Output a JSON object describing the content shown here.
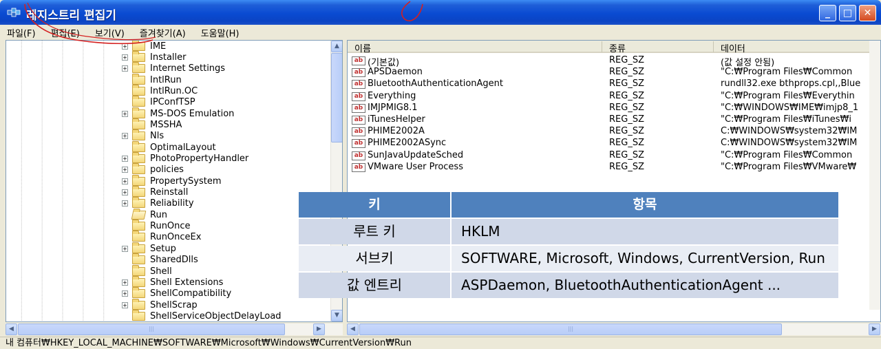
{
  "window": {
    "title": "레지스트리 편집기",
    "buttons": {
      "minimize": "_",
      "maximize": "□",
      "close": "✕"
    }
  },
  "menu": [
    "파일(F)",
    "편집(E)",
    "보기(V)",
    "즐겨찾기(A)",
    "도움말(H)"
  ],
  "tree": {
    "items": [
      {
        "label": "IME",
        "expandable": true
      },
      {
        "label": "Installer",
        "expandable": true
      },
      {
        "label": "Internet Settings",
        "expandable": true
      },
      {
        "label": "IntlRun",
        "expandable": false
      },
      {
        "label": "IntlRun.OC",
        "expandable": false
      },
      {
        "label": "IPConfTSP",
        "expandable": false
      },
      {
        "label": "MS-DOS Emulation",
        "expandable": true
      },
      {
        "label": "MSSHA",
        "expandable": false
      },
      {
        "label": "Nls",
        "expandable": true
      },
      {
        "label": "OptimalLayout",
        "expandable": false
      },
      {
        "label": "PhotoPropertyHandler",
        "expandable": true
      },
      {
        "label": "policies",
        "expandable": true
      },
      {
        "label": "PropertySystem",
        "expandable": true
      },
      {
        "label": "Reinstall",
        "expandable": true
      },
      {
        "label": "Reliability",
        "expandable": true
      },
      {
        "label": "Run",
        "expandable": false,
        "open": true
      },
      {
        "label": "RunOnce",
        "expandable": false
      },
      {
        "label": "RunOnceEx",
        "expandable": false
      },
      {
        "label": "Setup",
        "expandable": true
      },
      {
        "label": "SharedDlls",
        "expandable": false
      },
      {
        "label": "Shell",
        "expandable": false
      },
      {
        "label": "Shell Extensions",
        "expandable": true
      },
      {
        "label": "ShellCompatibility",
        "expandable": true
      },
      {
        "label": "ShellScrap",
        "expandable": true
      },
      {
        "label": "ShellServiceObjectDelayLoad",
        "expandable": false
      }
    ]
  },
  "list": {
    "headers": [
      "이름",
      "종류",
      "데이터"
    ],
    "icon_text": "ab",
    "rows": [
      {
        "name": "(기본값)",
        "type": "REG_SZ",
        "data": "(값 설정 안됨)"
      },
      {
        "name": "APSDaemon",
        "type": "REG_SZ",
        "data": "\"C:₩Program Files₩Common"
      },
      {
        "name": "BluetoothAuthenticationAgent",
        "type": "REG_SZ",
        "data": "rundll32.exe bthprops.cpl,,Blue"
      },
      {
        "name": "Everything",
        "type": "REG_SZ",
        "data": "\"C:₩Program Files₩Everythin"
      },
      {
        "name": "IMJPMIG8.1",
        "type": "REG_SZ",
        "data": "\"C:₩WINDOWS₩IME₩imjp8_1"
      },
      {
        "name": "iTunesHelper",
        "type": "REG_SZ",
        "data": "\"C:₩Program Files₩iTunes₩i"
      },
      {
        "name": "PHIME2002A",
        "type": "REG_SZ",
        "data": "C:₩WINDOWS₩system32₩IM"
      },
      {
        "name": "PHIME2002ASync",
        "type": "REG_SZ",
        "data": "C:₩WINDOWS₩system32₩IM"
      },
      {
        "name": "SunJavaUpdateSched",
        "type": "REG_SZ",
        "data": "\"C:₩Program Files₩Common"
      },
      {
        "name": "VMware User Process",
        "type": "REG_SZ",
        "data": "\"C:₩Program Files₩VMware₩"
      }
    ]
  },
  "overlay_table": {
    "headers": [
      "키",
      "항목"
    ],
    "rows": [
      {
        "key": "루트 키",
        "value": "HKLM"
      },
      {
        "key": "서브키",
        "value": "SOFTWARE, Microsoft, Windows, CurrentVersion, Run"
      },
      {
        "key": "값 엔트리",
        "value": "ASPDaemon, BluetoothAuthenticationAgent ..."
      }
    ]
  },
  "status": "내 컴퓨터₩HKEY_LOCAL_MACHINE₩SOFTWARE₩Microsoft₩Windows₩CurrentVersion₩Run",
  "colors": {
    "title_bar": "#0a4bd2",
    "overlay_header": "#4f81bd",
    "annotation": "#d42020"
  }
}
